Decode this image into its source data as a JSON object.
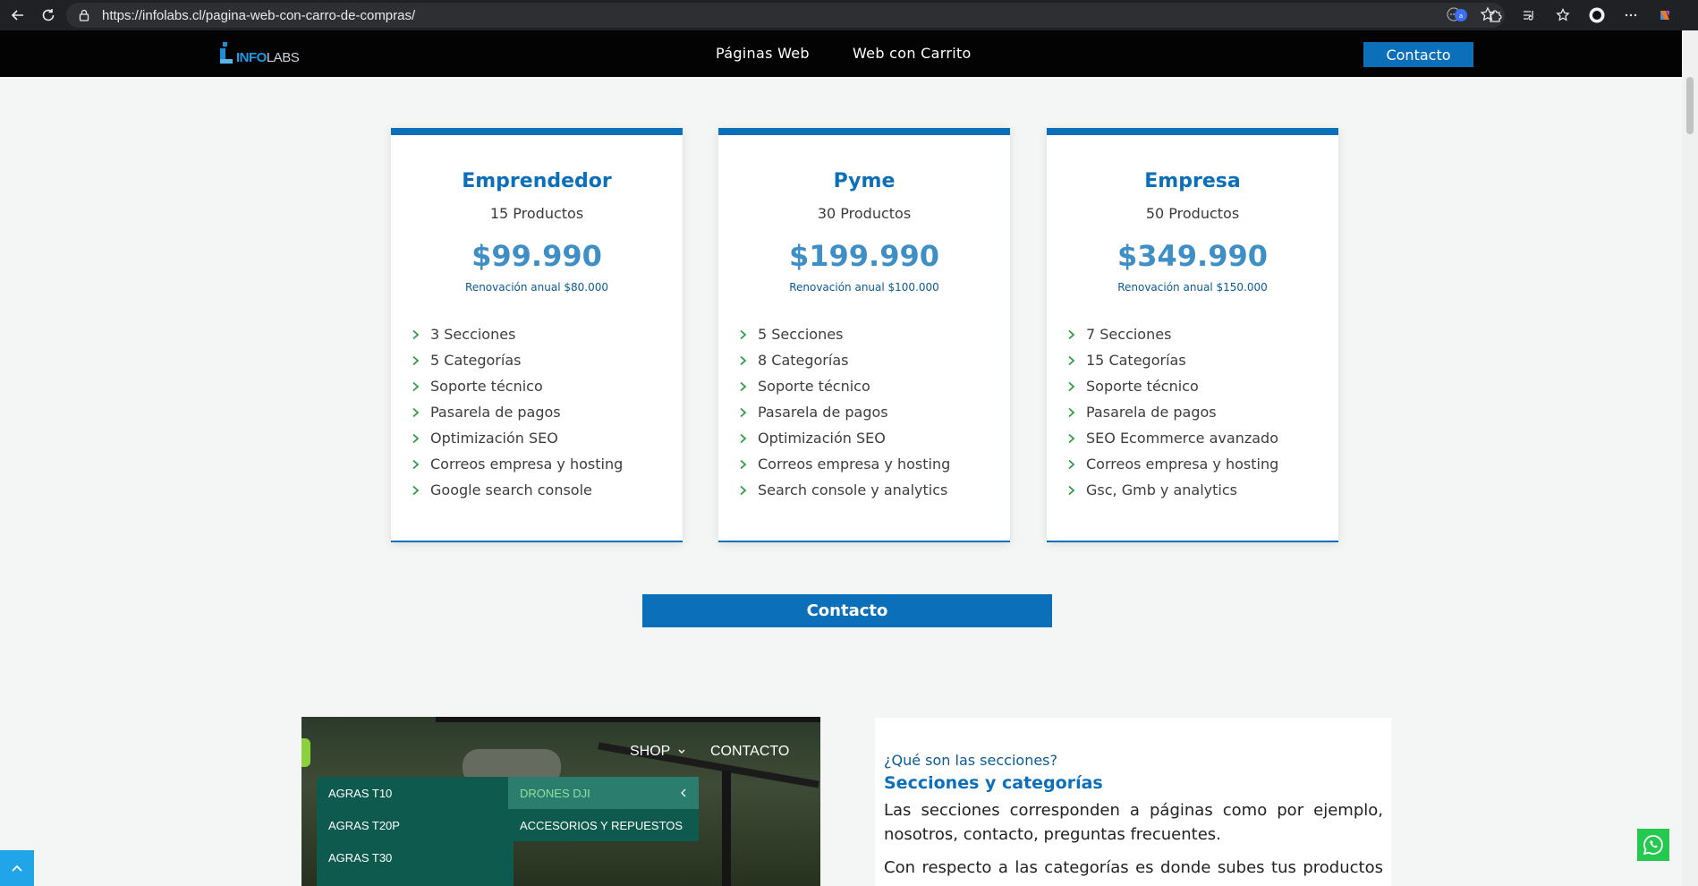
{
  "browser": {
    "url": "https://infolabs.cl/pagina-web-con-carro-de-compras/"
  },
  "header": {
    "logo_part1": "INFO",
    "logo_part2": "LABS",
    "nav": [
      "Páginas Web",
      "Web con Carrito"
    ],
    "cta_label": "Contacto"
  },
  "plans": [
    {
      "name": "Emprendedor",
      "products": "15 Productos",
      "price": "$99.990",
      "renewal": "Renovación anual $80.000",
      "features": [
        "3 Secciones",
        "5 Categorías",
        "Soporte técnico",
        "Pasarela de pagos",
        "Optimización SEO",
        "Correos empresa y hosting",
        "Google search console"
      ]
    },
    {
      "name": "Pyme",
      "products": "30 Productos",
      "price": "$199.990",
      "renewal": "Renovación anual $100.000",
      "features": [
        "5 Secciones",
        "8 Categorías",
        "Soporte técnico",
        "Pasarela de pagos",
        "Optimización SEO",
        "Correos empresa y hosting",
        "Search console y analytics"
      ]
    },
    {
      "name": "Empresa",
      "products": "50 Productos",
      "price": "$349.990",
      "renewal": "Renovación anual $150.000",
      "features": [
        "7 Secciones",
        "15 Categorías",
        "Soporte técnico",
        "Pasarela de pagos",
        "SEO Ecommerce avanzado",
        "Correos empresa y hosting",
        "Gsc, Gmb y analytics"
      ]
    }
  ],
  "main_cta": "Contacto",
  "preview": {
    "nav_shop": "SHOP",
    "nav_contacto": "CONTACTO",
    "menu_left": [
      "AGRAS T10",
      "AGRAS T20P",
      "AGRAS T30"
    ],
    "menu_right": [
      "DRONES DJI",
      "ACCESORIOS Y REPUESTOS"
    ]
  },
  "info": {
    "question": "¿Qué son las secciones?",
    "heading": "Secciones y categorías",
    "paragraph1": "Las secciones corresponden a páginas como por ejemplo, nosotros, contacto, preguntas frecuentes.",
    "paragraph2": "Con respecto a las categorías es donde subes tus productos y"
  },
  "colors": {
    "brand_blue": "#0b6fba",
    "price_blue": "#3f8fc7",
    "check_green": "#2e9e44",
    "header_bg": "#030303"
  }
}
